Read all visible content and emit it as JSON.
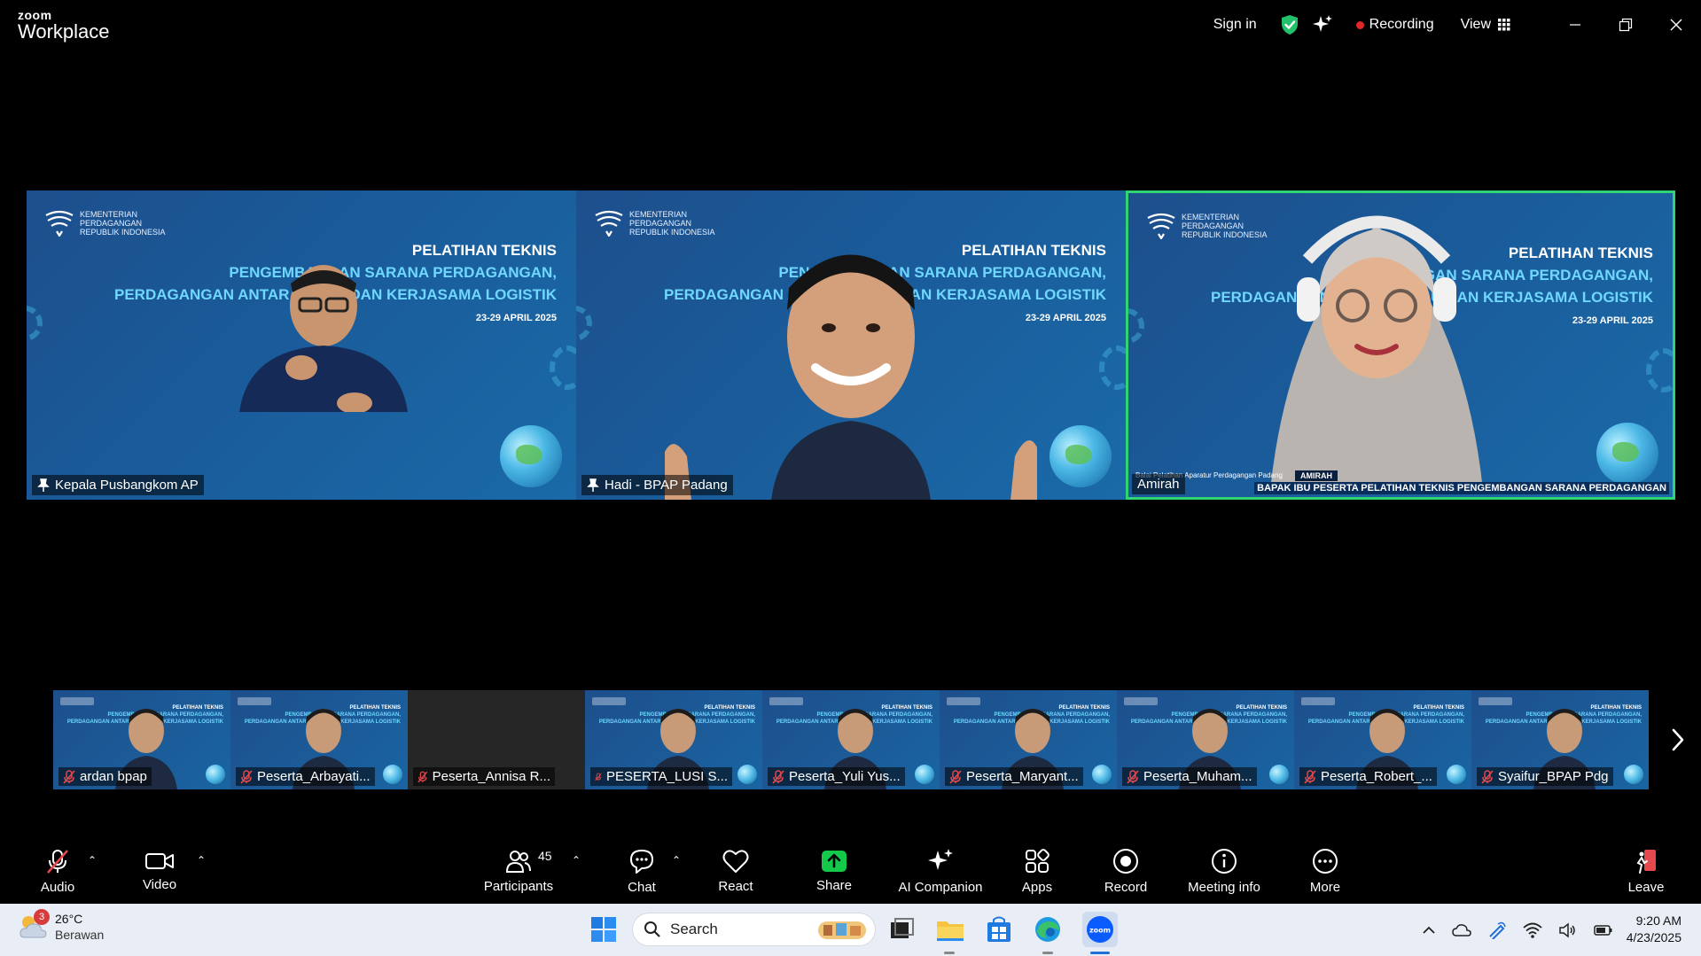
{
  "app": {
    "brand_small": "zoom",
    "brand_big": "Workplace"
  },
  "titlebar": {
    "signin": "Sign in",
    "recording": "Recording",
    "view": "View"
  },
  "tiles": [
    {
      "org": [
        "KEMENTERIAN",
        "PERDAGANGAN",
        "REPUBLIK INDONESIA"
      ],
      "line1": "PELATIHAN TEKNIS",
      "line2": "PENGEMBANGAN SARANA PERDAGANGAN,",
      "line3": "PERDAGANGAN ANTAR PULAU DAN KERJASAMA LOGISTIK",
      "date": "23-29 APRIL 2025",
      "name": "Kepala Pusbangkom AP"
    },
    {
      "org": [
        "KEMENTERIAN",
        "PERDAGANGAN",
        "REPUBLIK INDONESIA"
      ],
      "line1": "PELATIHAN TEKNIS",
      "line2": "PENGEMBANGAN SARANA PERDAGANGAN,",
      "line3": "PERDAGANGAN ANTAR PULAU DAN KERJASAMA LOGISTIK",
      "date": "23-29 APRIL 2025",
      "name": "Hadi - BPAP Padang"
    },
    {
      "org": [
        "KEMENTERIAN",
        "PERDAGANGAN",
        "REPUBLIK INDONESIA"
      ],
      "line1": "PELATIHAN TEKNIS",
      "line2": "PENGEMBANGAN SARANA PERDAGANGAN,",
      "line3": "PERDAGANGAN ANTAR PULAU DAN KERJASAMA LOGISTIK",
      "date": "23-29 APRIL 2025",
      "name": "Amirah",
      "lower_org": "Balai Pelatihan Aparatur Perdagangan Padang",
      "lower_name": "AMIRAH",
      "lower_ticker": "BAPAK IBU PESERTA PELATIHAN TEKNIS PENGEMBANGAN SARANA PERDAGANGAN"
    }
  ],
  "gallery": [
    {
      "name": "ardan bpap",
      "video": true
    },
    {
      "name": "Peserta_Arbayati...",
      "video": true
    },
    {
      "name": "Peserta_Annisa R...",
      "video": false
    },
    {
      "name": "PESERTA_LUSI S...",
      "video": true
    },
    {
      "name": "Peserta_Yuli Yus...",
      "video": true
    },
    {
      "name": "Peserta_Maryant...",
      "video": true
    },
    {
      "name": "Peserta_Muham...",
      "video": true
    },
    {
      "name": "Peserta_Robert_...",
      "video": true
    },
    {
      "name": "Syaifur_BPAP Pdg",
      "video": true
    }
  ],
  "thumb_title": [
    "PELATIHAN TEKNIS",
    "PENGEMBANGAN SARANA PERDAGANGAN,",
    "PERDAGANGAN ANTAR PULAU DAN KERJASAMA LOGISTIK"
  ],
  "toolbar": {
    "audio": "Audio",
    "video": "Video",
    "participants": "Participants",
    "participants_count": "45",
    "chat": "Chat",
    "react": "React",
    "share": "Share",
    "ai": "AI Companion",
    "apps": "Apps",
    "record": "Record",
    "info": "Meeting info",
    "more": "More",
    "leave": "Leave"
  },
  "taskbar": {
    "weather_badge": "3",
    "temp": "26°C",
    "condition": "Berawan",
    "search": "Search",
    "time": "9:20 AM",
    "date": "4/23/2025"
  },
  "colors": {
    "active_border": "#2fd573",
    "share_green": "#14c94a",
    "recording_red": "#e02828",
    "leave_red": "#e5484d"
  }
}
